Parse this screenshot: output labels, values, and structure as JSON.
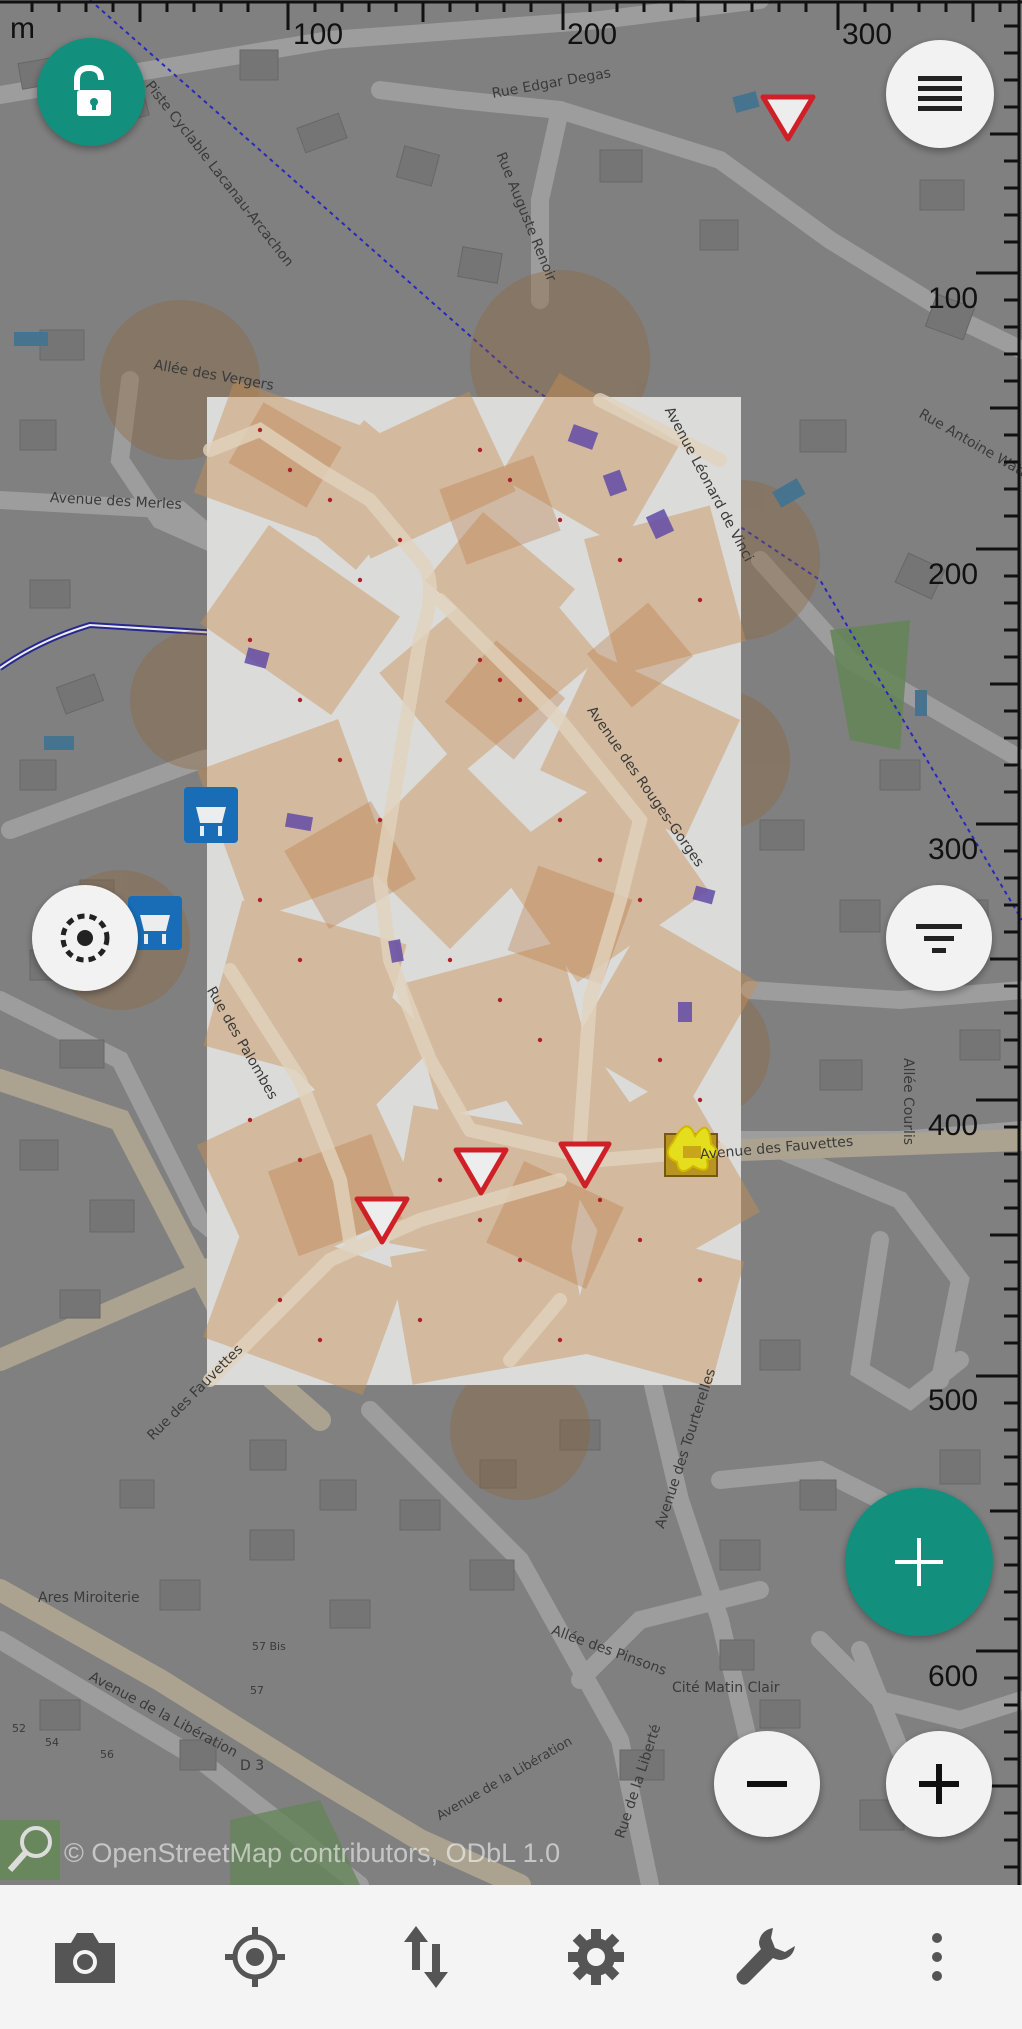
{
  "ruler": {
    "unit": "m",
    "top_ticks": [
      "100",
      "200",
      "300"
    ],
    "right_ticks": [
      "100",
      "200",
      "300",
      "400",
      "500",
      "600"
    ]
  },
  "map": {
    "attribution": "© OpenStreetMap contributors, ODbL 1.0",
    "streets": [
      "Piste Cyclable Lacanau-Arcachon",
      "Rue Edgar Degas",
      "Rue Auguste Renoir",
      "Rue Antoine Watteau",
      "Avenue des Merles",
      "Allée des Vergers",
      "Allée Courlis",
      "Avenue des Fauvettes",
      "Avenue des Tourterelles",
      "Allée des Pinsons",
      "Cité Matin Clair",
      "Avenue de la Libération",
      "Rue de la Liberté",
      "D 3",
      "Ares Miroiterie",
      "57 Bis",
      "57",
      "54",
      "56",
      "52",
      "Avenue de la Libération",
      "Rue des Fauvettes",
      "Rue des Palombes",
      "Avenue des Rouges-Gorges",
      "Avenue Léonard de Vinci"
    ]
  },
  "colors": {
    "teal": "#138f7e",
    "overlay": "#d89b5a",
    "white_fab": "#f2f2f2",
    "give_way_red": "#e0232a"
  },
  "icons": {
    "lock": "lock-open-icon",
    "menu": "menu-icon",
    "gps": "gps-locate-icon",
    "filter": "filter-icon",
    "add": "add-icon",
    "zoom_out": "zoom-out-icon",
    "zoom_in": "zoom-in-icon",
    "camera": "camera-icon",
    "target": "gps-target-icon",
    "transfer": "transfer-icon",
    "settings": "gear-icon",
    "tools": "wrench-icon",
    "more": "more-vert-icon"
  }
}
